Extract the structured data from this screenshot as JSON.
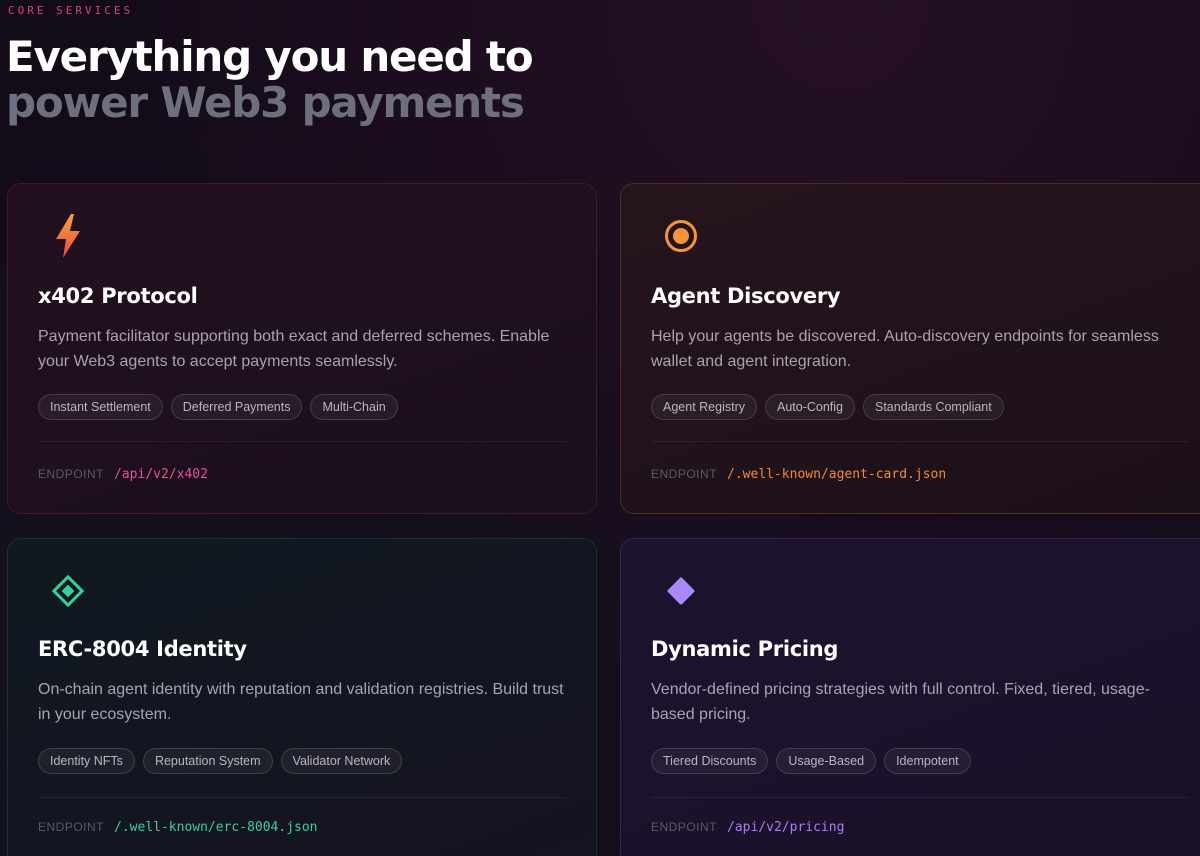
{
  "section": {
    "eyebrow": "CORE SERVICES",
    "headline_line1": "Everything you need to",
    "headline_line2": "power Web3 payments"
  },
  "endpoint_label": "ENDPOINT",
  "cards": [
    {
      "icon": "lightning-icon",
      "accent": "#e2559a",
      "title": "x402 Protocol",
      "description": "Payment facilitator supporting both exact and deferred schemes. Enable your Web3 agents to accept payments seamlessly.",
      "tags": [
        "Instant Settlement",
        "Deferred Payments",
        "Multi-Chain"
      ],
      "endpoint": "/api/v2/x402"
    },
    {
      "icon": "target-icon",
      "accent": "#f08a3a",
      "title": "Agent Discovery",
      "description": "Help your agents be discovered. Auto-discovery endpoints for seamless wallet and agent integration.",
      "tags": [
        "Agent Registry",
        "Auto-Config",
        "Standards Compliant"
      ],
      "endpoint": "/.well-known/agent-card.json"
    },
    {
      "icon": "diamond-outline-icon",
      "accent": "#3ccf97",
      "title": "ERC-8004 Identity",
      "description": "On-chain agent identity with reputation and validation registries. Build trust in your ecosystem.",
      "tags": [
        "Identity NFTs",
        "Reputation System",
        "Validator Network"
      ],
      "endpoint": "/.well-known/erc-8004.json"
    },
    {
      "icon": "diamond-icon",
      "accent": "#a97cf6",
      "title": "Dynamic Pricing",
      "description": "Vendor-defined pricing strategies with full control. Fixed, tiered, usage-based pricing.",
      "tags": [
        "Tiered Discounts",
        "Usage-Based",
        "Idempotent"
      ],
      "endpoint": "/api/v2/pricing"
    }
  ]
}
